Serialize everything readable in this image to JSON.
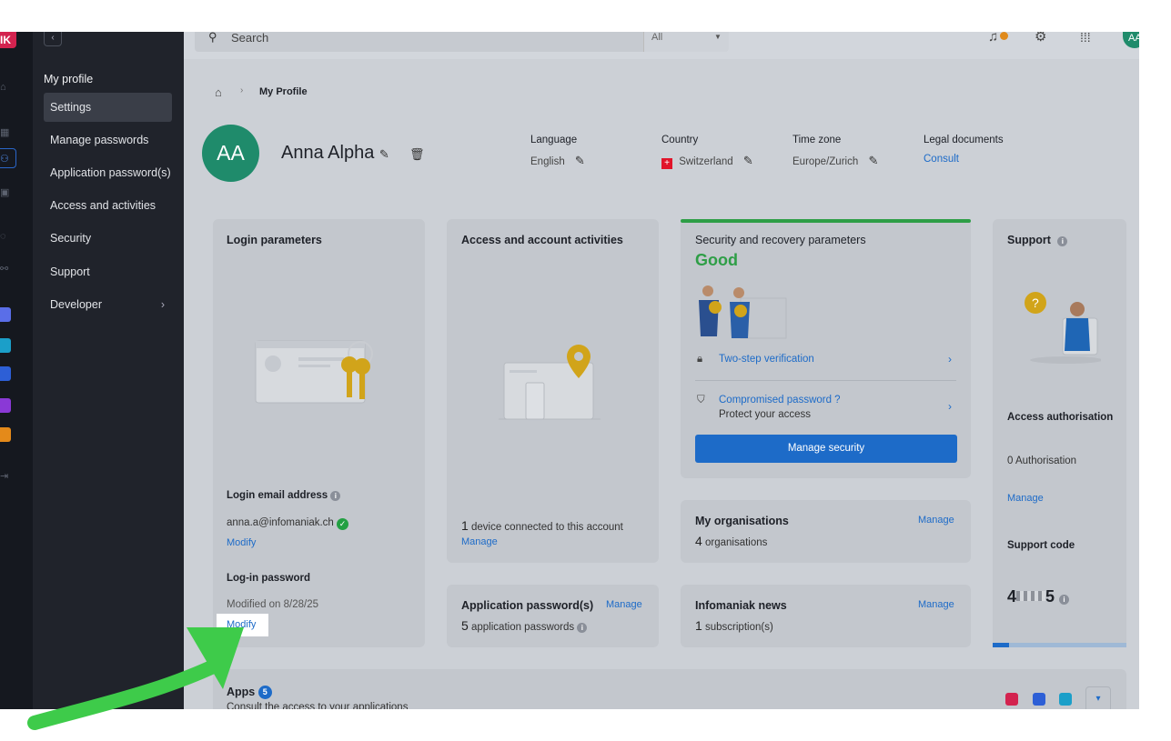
{
  "colors": {
    "accent": "#1d6bc8",
    "good": "#2e9e46",
    "avatar": "#1f8b6b",
    "brand": "#d3234f",
    "arrow": "#3ecb4a"
  },
  "rail": {
    "logo": "IK"
  },
  "nav": {
    "title": "My profile",
    "items": [
      {
        "label": "Settings"
      },
      {
        "label": "Manage passwords"
      },
      {
        "label": "Application password(s)"
      },
      {
        "label": "Access and activities"
      },
      {
        "label": "Security"
      },
      {
        "label": "Support"
      },
      {
        "label": "Developer"
      }
    ]
  },
  "search": {
    "placeholder": "Search",
    "filter": "All"
  },
  "user": {
    "initials": "AA",
    "initials_small": "AA"
  },
  "breadcrumb": {
    "current": "My Profile"
  },
  "profile": {
    "name": "Anna Alpha",
    "language_label": "Language",
    "language_value": "English",
    "country_label": "Country",
    "country_value": "Switzerland",
    "timezone_label": "Time zone",
    "timezone_value": "Europe/Zurich",
    "legal_label": "Legal documents",
    "legal_link": "Consult"
  },
  "login": {
    "title": "Login parameters",
    "email_label": "Login email address",
    "email": "anna.a@infomaniak.ch",
    "modify_email": "Modify",
    "password_label": "Log-in password",
    "modified_on": "Modified on 8/28/25",
    "modify_password": "Modify"
  },
  "access": {
    "title": "Access and account activities",
    "device_count": "1",
    "device_text": "device connected to this account",
    "manage": "Manage"
  },
  "security": {
    "title": "Security and recovery parameters",
    "status": "Good",
    "two_step": "Two-step verification",
    "compromised": "Compromised password ?",
    "protect": "Protect your access",
    "button": "Manage security"
  },
  "support": {
    "title": "Support",
    "auth_title": "Access authorisation",
    "auth_value": "0 Authorisation",
    "manage": "Manage",
    "code_title": "Support code",
    "code_start": "4",
    "code_end": "5"
  },
  "orgs": {
    "title": "My organisations",
    "count": "4",
    "unit": "organisations",
    "manage": "Manage"
  },
  "app_passwords": {
    "title": "Application password(s)",
    "count": "5",
    "unit": "application passwords",
    "manage": "Manage"
  },
  "news": {
    "title": "Infomaniak news",
    "count": "1",
    "unit": "subscription(s)",
    "manage": "Manage"
  },
  "apps": {
    "title": "Apps",
    "badge": "5",
    "subtitle": "Consult the access to your applications"
  }
}
